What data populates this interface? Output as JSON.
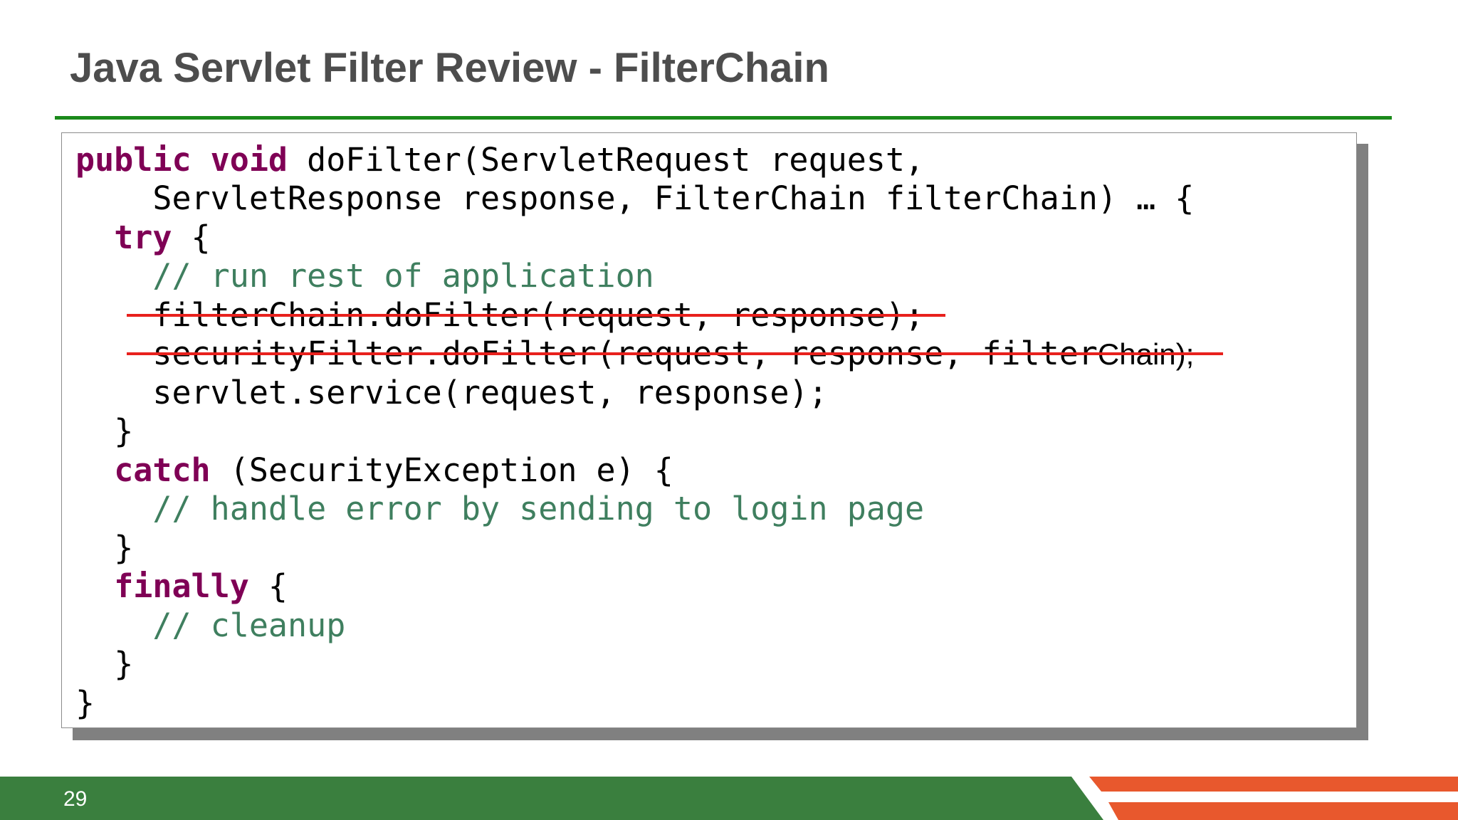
{
  "slide": {
    "title": "Java Servlet Filter Review - FilterChain",
    "page_number": "29",
    "colors": {
      "title": "#4d4d4d",
      "rule": "#1b8a1b",
      "footer": "#3a7f3e",
      "accent_orange": "#e8582d",
      "keyword": "#7f0055",
      "comment": "#3f7f5f",
      "strike": "#e8211d"
    }
  },
  "code": {
    "l1_kw1": "public",
    "l1_kw2": "void",
    "l1_rest": " doFilter(ServletRequest request,",
    "l2": "    ServletResponse response, FilterChain filterChain) … {",
    "l3_kw": "try",
    "l3_rest": " {",
    "l4_comment": "// run rest of application",
    "l5": "filterChain.doFilter(request, response);",
    "l6_mono": "securityFilter.doFilter(request, response, filter",
    "l6_tail": "Chain);",
    "l7": "servlet.service(request, response);",
    "l8": "}",
    "l9_kw": "catch",
    "l9_rest": " (SecurityException e) {",
    "l10_comment": "// handle error by sending to login page",
    "l11": "}",
    "l12_kw": "finally",
    "l12_rest": " {",
    "l13_comment": "// cleanup",
    "l14": "}",
    "l15": "}"
  }
}
